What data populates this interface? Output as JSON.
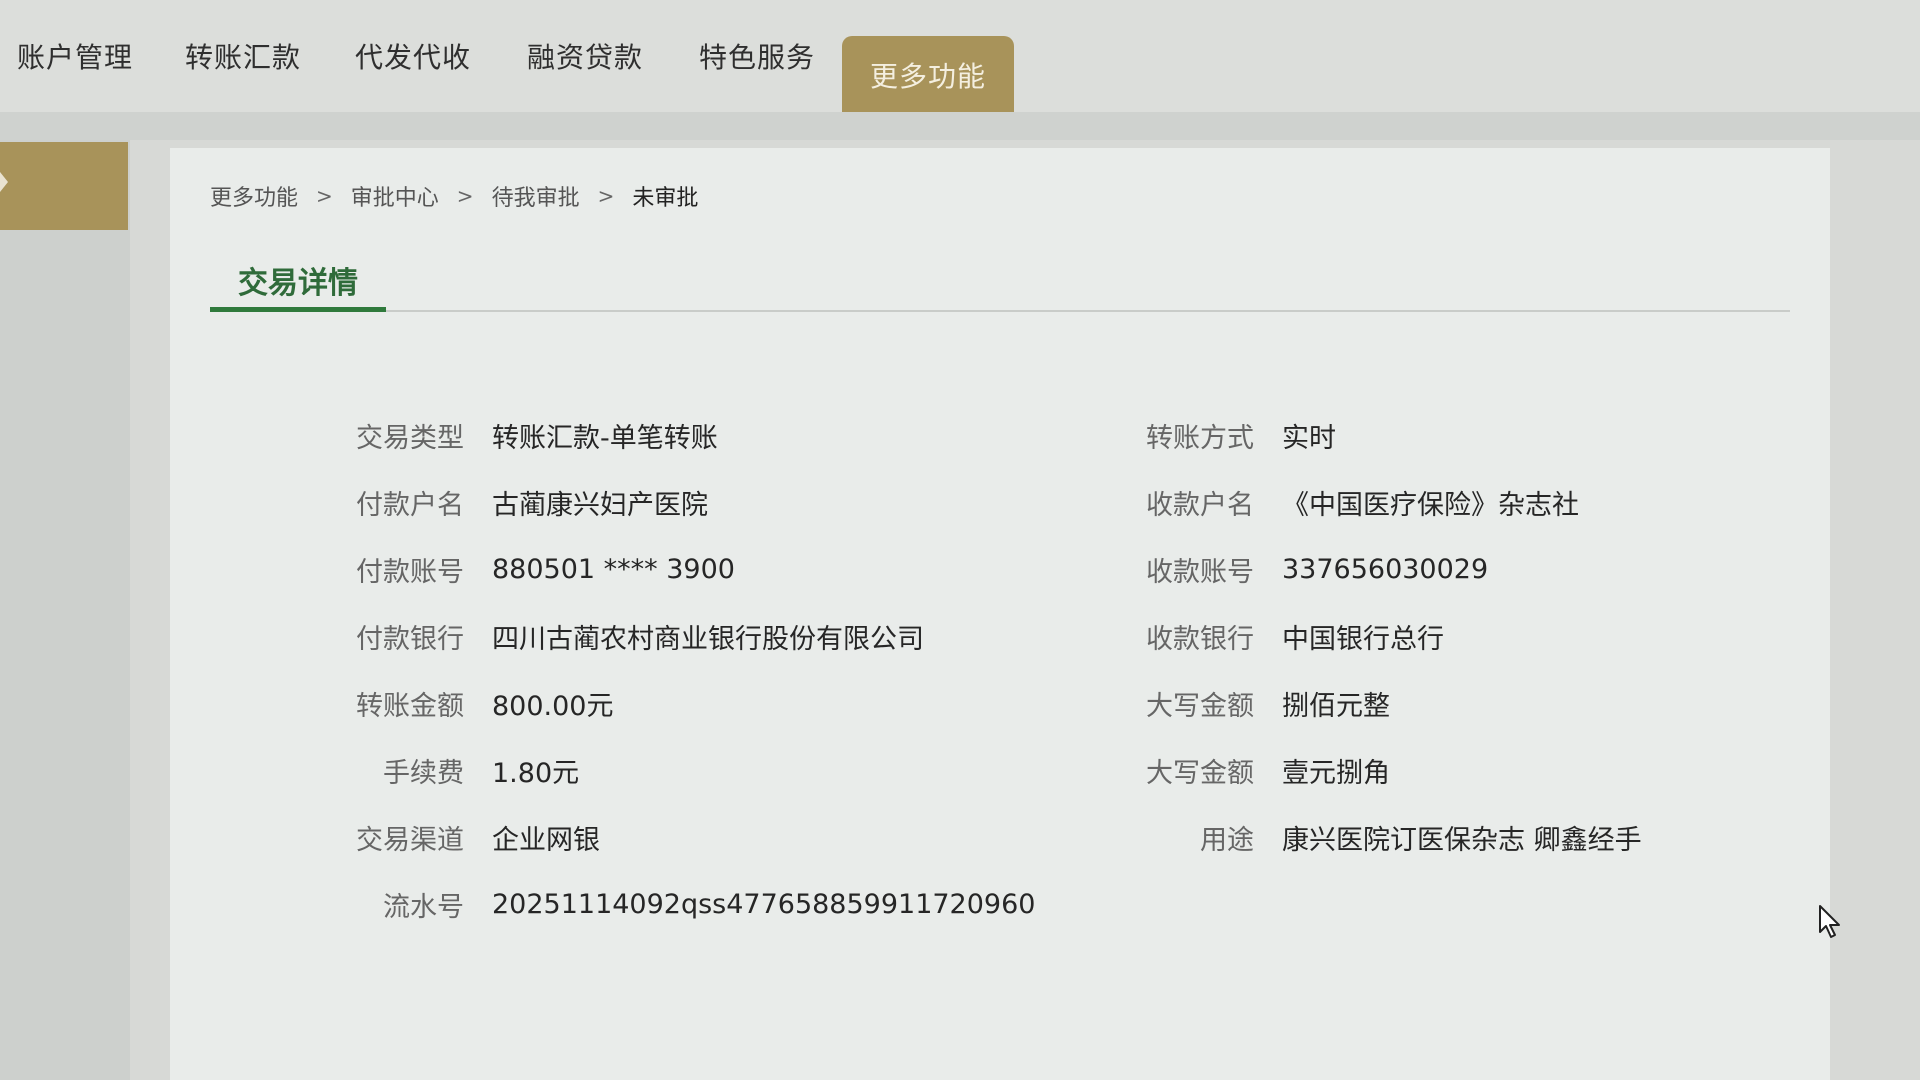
{
  "nav": {
    "items": [
      {
        "label": "账户管理"
      },
      {
        "label": "转账汇款"
      },
      {
        "label": "代发代收"
      },
      {
        "label": "融资贷款"
      },
      {
        "label": "特色服务"
      },
      {
        "label": "更多功能",
        "active": true
      }
    ]
  },
  "breadcrumb": {
    "items": [
      "更多功能",
      "审批中心",
      "待我审批",
      "未审批"
    ],
    "separator": ">"
  },
  "tab": {
    "title": "交易详情"
  },
  "details": {
    "left": [
      {
        "label": "交易类型",
        "value": "转账汇款-单笔转账"
      },
      {
        "label": "付款户名",
        "value": "古蔺康兴妇产医院"
      },
      {
        "label": "付款账号",
        "value": "880501 **** 3900"
      },
      {
        "label": "付款银行",
        "value": "四川古蔺农村商业银行股份有限公司"
      },
      {
        "label": "转账金额",
        "value": "800.00元"
      },
      {
        "label": "手续费",
        "value": "1.80元"
      },
      {
        "label": "交易渠道",
        "value": "企业网银"
      },
      {
        "label": "流水号",
        "value": "20251114092qss477658859911720960"
      }
    ],
    "right": [
      {
        "label": "转账方式",
        "value": "实时"
      },
      {
        "label": "收款户名",
        "value": "《中国医疗保险》杂志社"
      },
      {
        "label": "收款账号",
        "value": "337656030029"
      },
      {
        "label": "收款银行",
        "value": "中国银行总行"
      },
      {
        "label": "大写金额",
        "value": "捌佰元整"
      },
      {
        "label": "大写金额",
        "value": "壹元捌角"
      },
      {
        "label": "用途",
        "value": "康兴医院订医保杂志 卿鑫经手"
      }
    ]
  },
  "colors": {
    "accent": "#a8935a",
    "tab_green": "#2f7a3c"
  },
  "icons": {
    "cursor": "mouse-pointer-icon"
  }
}
